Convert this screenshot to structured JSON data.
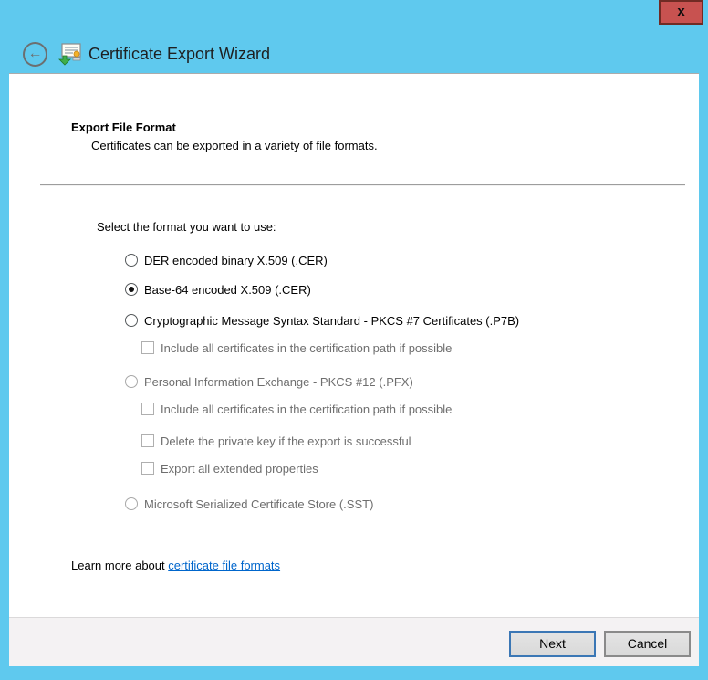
{
  "window": {
    "title": "Certificate Export Wizard",
    "close_label": "x",
    "back_glyph": "←"
  },
  "page": {
    "heading": "Export File Format",
    "subheading": "Certificates can be exported in a variety of file formats.",
    "prompt": "Select the format you want to use:",
    "options": [
      {
        "type": "radio",
        "label": "DER encoded binary X.509 (.CER)",
        "selected": false,
        "enabled": true
      },
      {
        "type": "radio",
        "label": "Base-64 encoded X.509 (.CER)",
        "selected": true,
        "enabled": true
      },
      {
        "type": "radio",
        "label": "Cryptographic Message Syntax Standard - PKCS #7 Certificates (.P7B)",
        "selected": false,
        "enabled": true
      },
      {
        "type": "checkbox",
        "label": "Include all certificates in the certification path if possible",
        "checked": false,
        "enabled": false
      },
      {
        "type": "radio",
        "label": "Personal Information Exchange - PKCS #12 (.PFX)",
        "selected": false,
        "enabled": false
      },
      {
        "type": "checkbox",
        "label": "Include all certificates in the certification path if possible",
        "checked": false,
        "enabled": false
      },
      {
        "type": "checkbox",
        "label": "Delete the private key if the export is successful",
        "checked": false,
        "enabled": false
      },
      {
        "type": "checkbox",
        "label": "Export all extended properties",
        "checked": false,
        "enabled": false
      },
      {
        "type": "radio",
        "label": "Microsoft Serialized Certificate Store (.SST)",
        "selected": false,
        "enabled": false
      }
    ],
    "learn_more_prefix": "Learn more about ",
    "learn_more_link": "certificate file formats"
  },
  "footer": {
    "next_label": "Next",
    "cancel_label": "Cancel"
  },
  "colors": {
    "frame_blue": "#5FC9EE",
    "close_red": "#C85250",
    "link_blue": "#0066CC",
    "disabled_text": "#6E6E6E",
    "next_border_blue": "#3B77B5",
    "footer_gray": "#F4F2F3"
  }
}
